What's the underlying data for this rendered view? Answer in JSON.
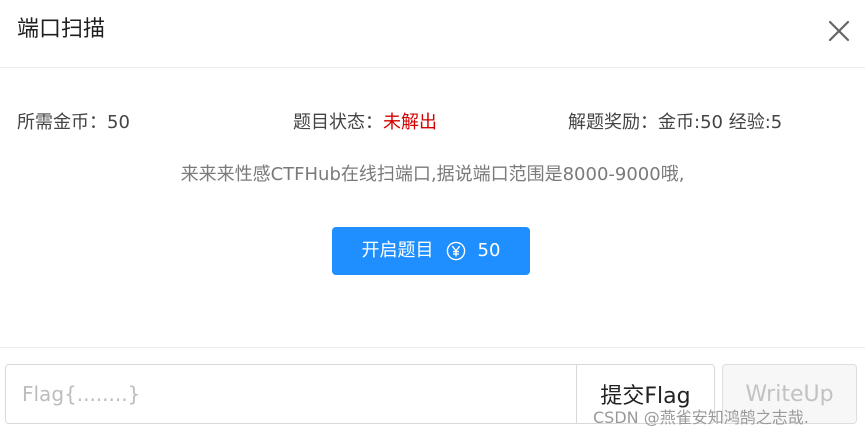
{
  "dialog": {
    "title": "端口扫描"
  },
  "info": {
    "cost_label": "所需金币：",
    "cost_value": "50",
    "status_label": "题目状态：",
    "status_value": "未解出",
    "reward_label": "解题奖励：",
    "reward_value": "金币:50 经验:5"
  },
  "description": "来来来性感CTFHub在线扫端口,据说端口范围是8000-9000哦,",
  "start_button": {
    "label": "开启题目",
    "icon": "yen-coin-icon",
    "cost": "50"
  },
  "footer": {
    "flag_placeholder": "Flag{........}",
    "flag_value": "",
    "submit_label": "提交Flag",
    "writeup_label": "WriteUp"
  },
  "watermark": "CSDN @燕雀安知鸿鹄之志哉.",
  "colors": {
    "primary": "#1f8fff",
    "status_unsolved": "#d40000",
    "text": "#444444",
    "muted": "#7a7a7a"
  }
}
